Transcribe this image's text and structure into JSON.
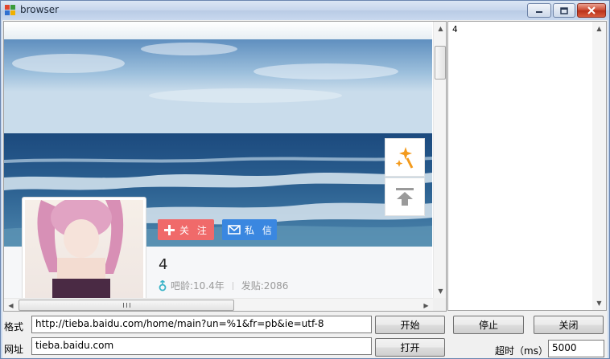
{
  "window": {
    "title": "browser"
  },
  "profile": {
    "follow_label": "关 注",
    "message_label": "私 信",
    "username": "4",
    "age_label": "吧龄:10.4年",
    "posts_label": "发贴:2086"
  },
  "output": {
    "text": "4"
  },
  "form": {
    "format_label": "格式",
    "format_value": "http://tieba.baidu.com/home/main?un=%1&fr=pb&ie=utf-8",
    "url_label": "网址",
    "url_value": "tieba.baidu.com",
    "start_label": "开始",
    "open_label": "打开",
    "stop_label": "停止",
    "close_label": "关闭",
    "timeout_label": "超时（ms）",
    "timeout_value": "5000"
  },
  "colors": {
    "follow": "#f06a6a",
    "message": "#3a87e0",
    "accent_orange": "#f39a1c",
    "gender_teal": "#3cb4c8"
  }
}
